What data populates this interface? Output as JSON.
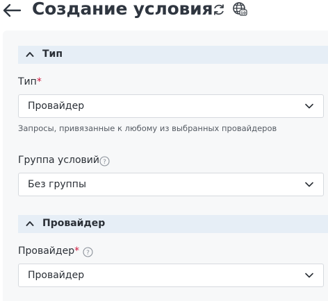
{
  "header": {
    "title": "Создание условия",
    "icons": [
      "arrow-left-icon",
      "refresh-icon",
      "globe-icon"
    ]
  },
  "section_type": {
    "title": "Тип",
    "field_label": "Тип",
    "required_mark": "*",
    "selected": "Провайдер",
    "hint": "Запросы, привязанные к любому из выбранных провайдеров"
  },
  "group_field": {
    "label": "Группа условий",
    "selected": "Без группы"
  },
  "section_provider": {
    "title": "Провайдер",
    "field_label": "Провайдер",
    "required_mark": "*",
    "selected": "Провайдер"
  },
  "colors": {
    "section_header_bg": "#e6eef6",
    "panel_bg": "#f7f8f9",
    "required": "#d0173c"
  }
}
